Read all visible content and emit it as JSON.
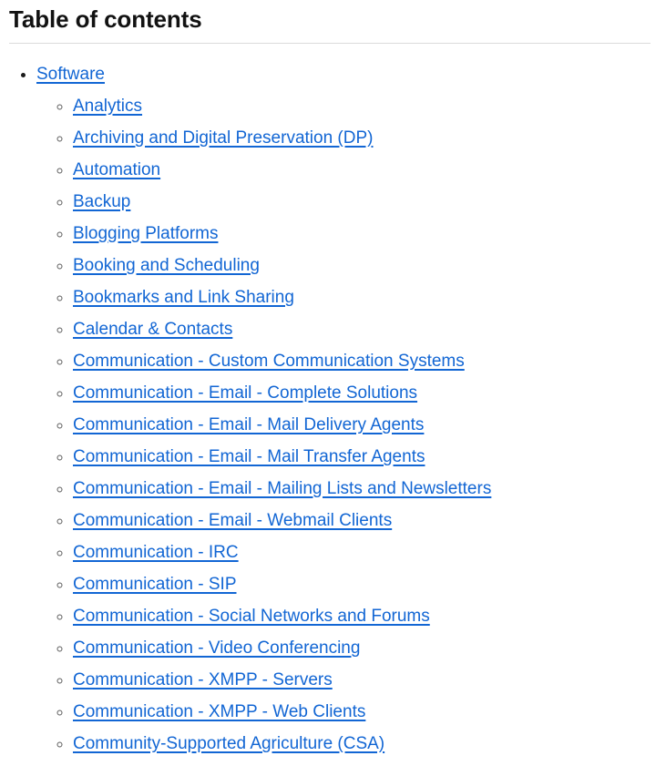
{
  "heading": "Table of contents",
  "colors": {
    "link": "#1266d4",
    "text": "#1b1b1b",
    "heading": "#121212",
    "divider": "#dcdcdc",
    "background": "#ffffff"
  },
  "toc": {
    "top_level": {
      "label": "Software",
      "marker": "disc"
    },
    "sub_marker": "circle",
    "items": [
      {
        "label": "Analytics"
      },
      {
        "label": "Archiving and Digital Preservation (DP)"
      },
      {
        "label": "Automation"
      },
      {
        "label": "Backup"
      },
      {
        "label": "Blogging Platforms"
      },
      {
        "label": "Booking and Scheduling"
      },
      {
        "label": "Bookmarks and Link Sharing"
      },
      {
        "label": "Calendar & Contacts"
      },
      {
        "label": "Communication - Custom Communication Systems"
      },
      {
        "label": "Communication - Email - Complete Solutions"
      },
      {
        "label": "Communication - Email - Mail Delivery Agents"
      },
      {
        "label": "Communication - Email - Mail Transfer Agents"
      },
      {
        "label": "Communication - Email - Mailing Lists and Newsletters"
      },
      {
        "label": "Communication - Email - Webmail Clients"
      },
      {
        "label": "Communication - IRC"
      },
      {
        "label": "Communication - SIP"
      },
      {
        "label": "Communication - Social Networks and Forums"
      },
      {
        "label": "Communication - Video Conferencing"
      },
      {
        "label": "Communication - XMPP - Servers"
      },
      {
        "label": "Communication - XMPP - Web Clients"
      },
      {
        "label": "Community-Supported Agriculture (CSA)"
      }
    ]
  }
}
